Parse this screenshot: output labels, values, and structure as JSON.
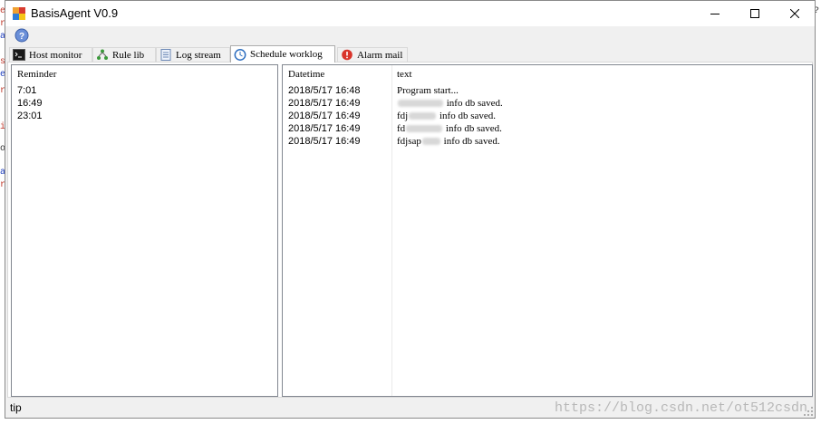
{
  "app": {
    "title": "BasisAgent V0.9",
    "accent": "#0078d7"
  },
  "toolbar": {
    "help_icon": "help-icon"
  },
  "tabs": [
    {
      "label": "Host monitor",
      "icon": "terminal-icon",
      "active": false
    },
    {
      "label": "Rule lib",
      "icon": "tree-icon",
      "active": false
    },
    {
      "label": "Log stream",
      "icon": "document-icon",
      "active": false
    },
    {
      "label": "Schedule worklog",
      "icon": "clock-icon",
      "active": true
    },
    {
      "label": "Alarm mail",
      "icon": "alert-icon",
      "active": false
    }
  ],
  "reminders": {
    "header": "Reminder",
    "rows": [
      "7:01",
      "16:49",
      "23:01"
    ]
  },
  "worklog": {
    "headers": {
      "datetime": "Datetime",
      "text": "text"
    },
    "rows": [
      {
        "datetime": "2018/5/17 16:48",
        "prefix": "Program start...",
        "suffix": ""
      },
      {
        "datetime": "2018/5/17 16:49",
        "prefix": "",
        "suffix": "info db saved."
      },
      {
        "datetime": "2018/5/17 16:49",
        "prefix": "fdj",
        "suffix": "info db saved."
      },
      {
        "datetime": "2018/5/17 16:49",
        "prefix": "fd",
        "suffix": "info db saved."
      },
      {
        "datetime": "2018/5/17 16:49",
        "prefix": "fdjsap",
        "suffix": "info db saved."
      }
    ]
  },
  "statusbar": {
    "text": "tip",
    "watermark": "https://blog.csdn.net/ot512csdn"
  }
}
